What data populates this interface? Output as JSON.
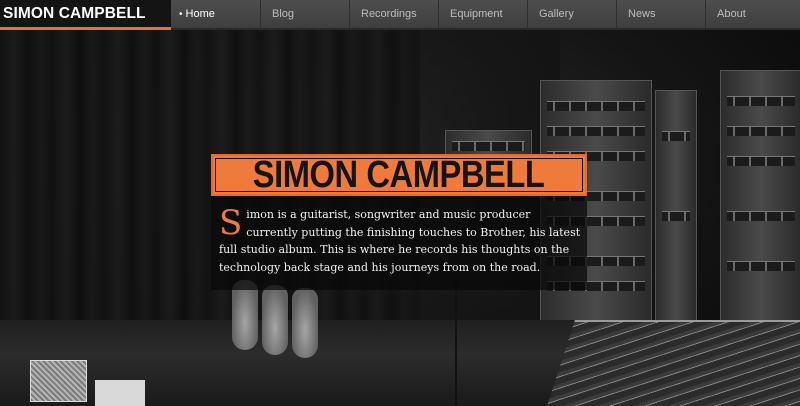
{
  "brand": {
    "name": "SIMON CAMPBELL"
  },
  "nav": {
    "items": [
      {
        "label": "Home",
        "active": true
      },
      {
        "label": "Blog",
        "active": false
      },
      {
        "label": "Recordings",
        "active": false
      },
      {
        "label": "Equipment",
        "active": false
      },
      {
        "label": "Gallery",
        "active": false
      },
      {
        "label": "News",
        "active": false
      },
      {
        "label": "About",
        "active": false
      }
    ]
  },
  "hero": {
    "title": "SIMON CAMPBELL",
    "dropcap": "S",
    "intro": "imon is a guitarist, songwriter and music producer currently putting the finishing touches to Brother, his latest full studio album. This is where he records his thoughts on the technology back stage and his journeys from on the road."
  },
  "colors": {
    "accent": "#f07a3c",
    "nav_background": "#474747",
    "brand_background": "#141414",
    "page_background": "#0d0d0d"
  }
}
